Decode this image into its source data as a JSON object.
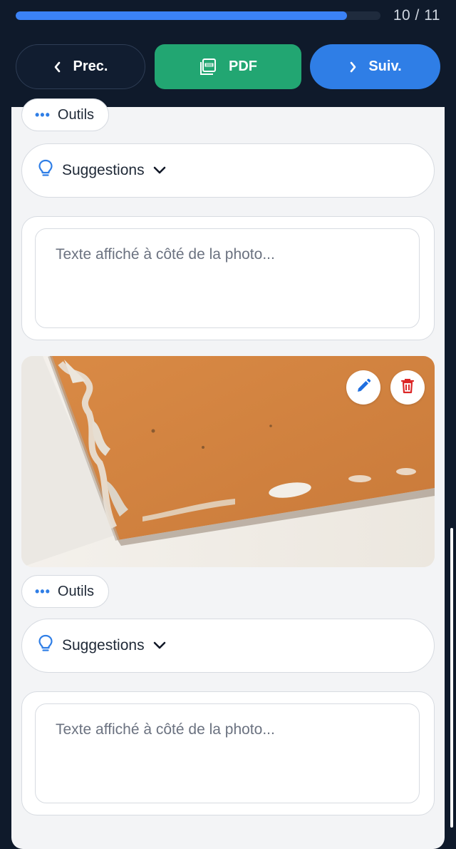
{
  "progress": {
    "text": "10 / 11",
    "fraction": 0.909
  },
  "nav": {
    "prev_label": "Prec.",
    "pdf_label": "PDF",
    "next_label": "Suiv."
  },
  "blocks": [
    {
      "tools_label": "Outils",
      "suggestions_label": "Suggestions",
      "caption_placeholder": "Texte affiché à côté de la photo..."
    },
    {
      "tools_label": "Outils",
      "suggestions_label": "Suggestions",
      "caption_placeholder": "Texte affiché à côté de la photo..."
    }
  ],
  "icons": {
    "prev": "chevron-left-icon",
    "pdf": "pdf-file-icon",
    "next": "chevron-right-icon",
    "tools": "more-horizontal-icon",
    "suggestions": "lightbulb-icon",
    "expand": "chevron-down-icon",
    "edit": "pencil-icon",
    "delete": "trash-icon"
  },
  "colors": {
    "header_bg": "#0f1a2b",
    "progress_fill": "#3b82f6",
    "pdf_button": "#22a672",
    "next_button": "#2f7ee6",
    "delete_red": "#dc2626",
    "accent_blue": "#2f7ee6"
  }
}
